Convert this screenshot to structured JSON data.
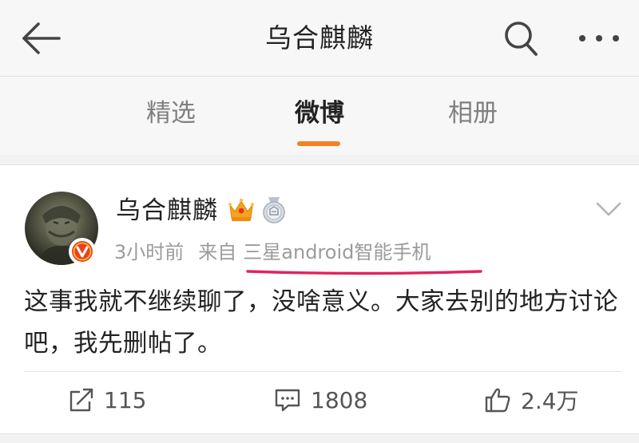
{
  "header": {
    "title": "乌合麒麟",
    "back_icon": "arrow-left-icon",
    "search_icon": "search-icon",
    "more_icon": "more-dots-icon"
  },
  "tabs": [
    {
      "label": "精选",
      "active": false
    },
    {
      "label": "微博",
      "active": true
    },
    {
      "label": "相册",
      "active": false
    }
  ],
  "post": {
    "author": "乌合麒麟",
    "badges": [
      "crown-icon",
      "medal-icon"
    ],
    "verified_icon": "verified-v-icon",
    "time": "3小时前",
    "source_prefix": "来自",
    "source_device": "三星android智能手机",
    "text": "这事我就不继续聊了，没啥意义。大家去别的地方讨论吧，我先删帖了。"
  },
  "actions": {
    "repost_count": "115",
    "comment_count": "1808",
    "like_count": "2.4万"
  },
  "colors": {
    "accent": "#f48221",
    "highlight": "#e0245e",
    "verified": "#e8431b",
    "text_primary": "#222222",
    "text_secondary": "#9b9b9b"
  }
}
